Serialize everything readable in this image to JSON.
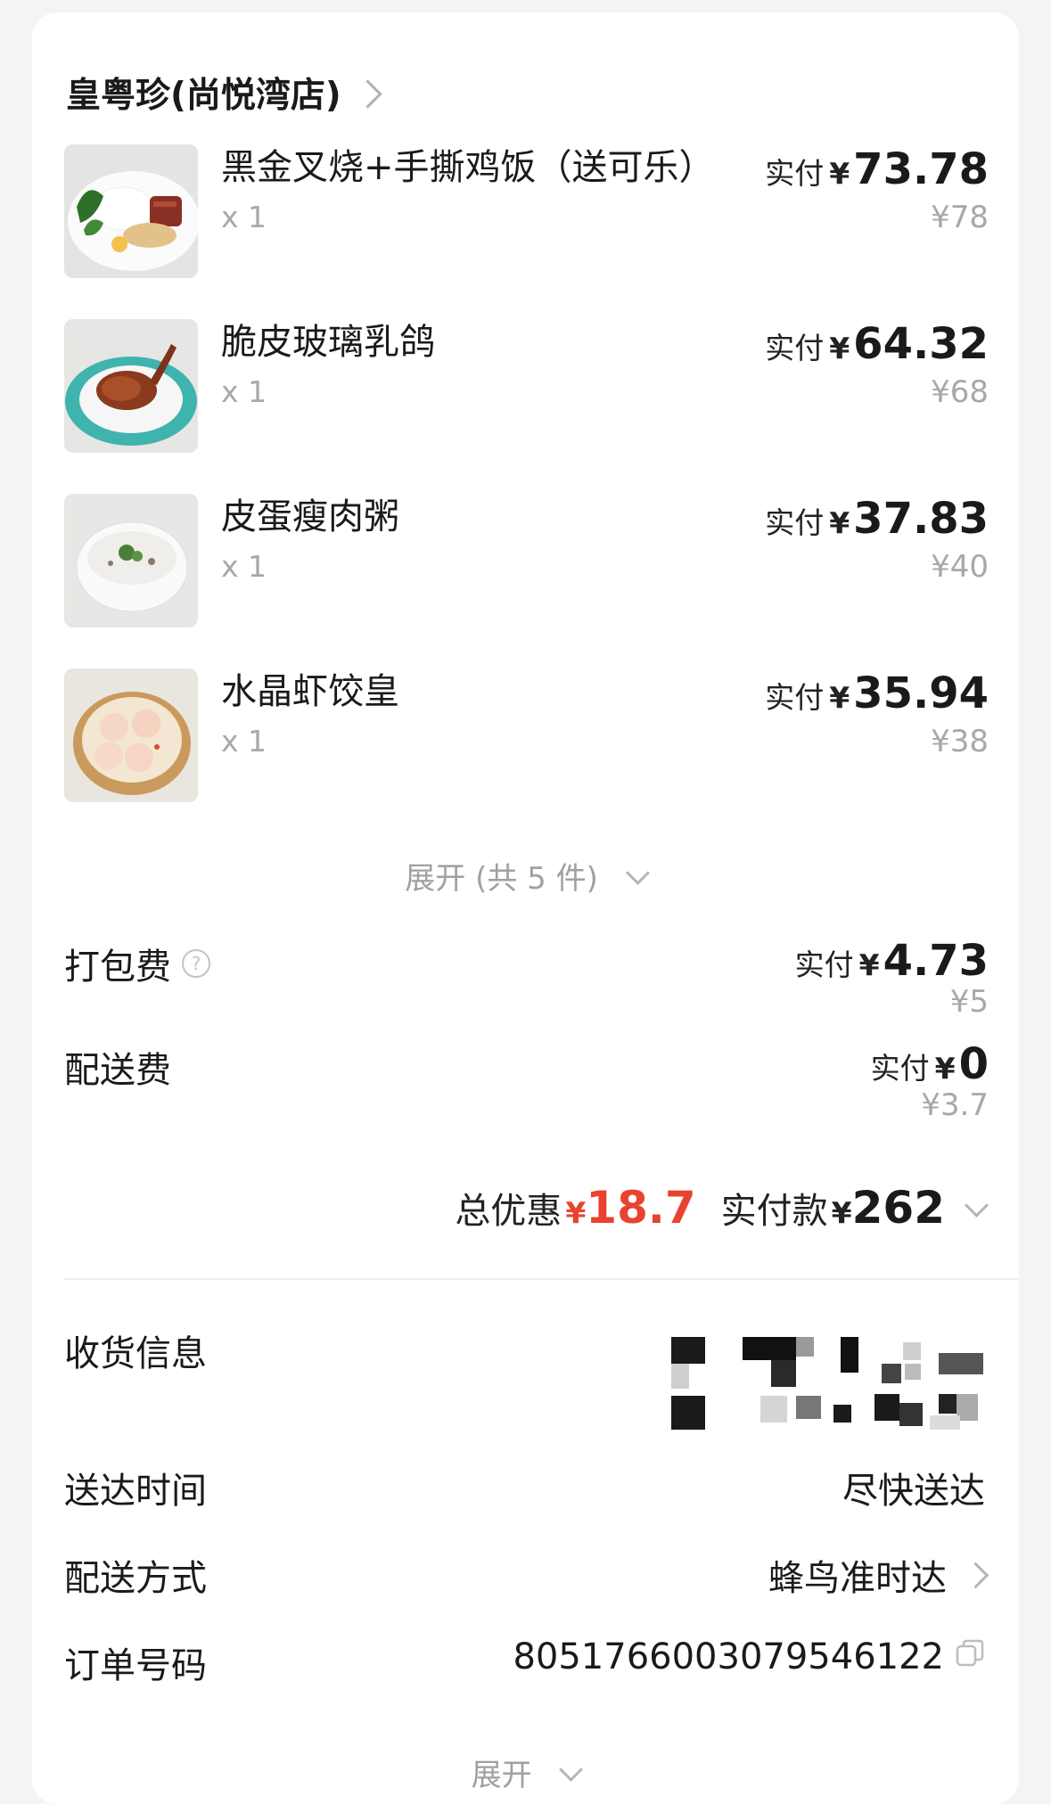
{
  "store": {
    "name": "皇粤珍(尚悦湾店)"
  },
  "paid_label": "实付",
  "currency": "¥",
  "items": [
    {
      "name": "黑金叉烧+手撕鸡饭（送可乐）",
      "qty": "x 1",
      "paid": "73.78",
      "original": "¥78",
      "image": "rice-plate"
    },
    {
      "name": "脆皮玻璃乳鸽",
      "qty": "x 1",
      "paid": "64.32",
      "original": "¥68",
      "image": "roast-pigeon"
    },
    {
      "name": "皮蛋瘦肉粥",
      "qty": "x 1",
      "paid": "37.83",
      "original": "¥40",
      "image": "congee-bowl"
    },
    {
      "name": "水晶虾饺皇",
      "qty": "x 1",
      "paid": "35.94",
      "original": "¥38",
      "image": "shrimp-dumplings"
    }
  ],
  "expand_items": "展开 (共 5 件)",
  "fees": {
    "packing": {
      "label": "打包费",
      "paid": "4.73",
      "original": "¥5"
    },
    "delivery": {
      "label": "配送费",
      "paid": "0",
      "original": "¥3.7"
    }
  },
  "summary": {
    "discount_label": "总优惠",
    "discount": "18.7",
    "total_label": "实付款",
    "total": "262"
  },
  "info": {
    "receiver_label": "收货信息",
    "receiver_value_pixelated": true,
    "time_label": "送达时间",
    "time_value": "尽快送达",
    "method_label": "配送方式",
    "method_value": "蜂鸟准时达",
    "order_label": "订单号码",
    "order_value": "8051766003079546122"
  },
  "expand_bottom": "展开",
  "colors": {
    "accent_red": "#e8432f",
    "muted": "#a8a8a8",
    "background": "#f4f4f4"
  }
}
